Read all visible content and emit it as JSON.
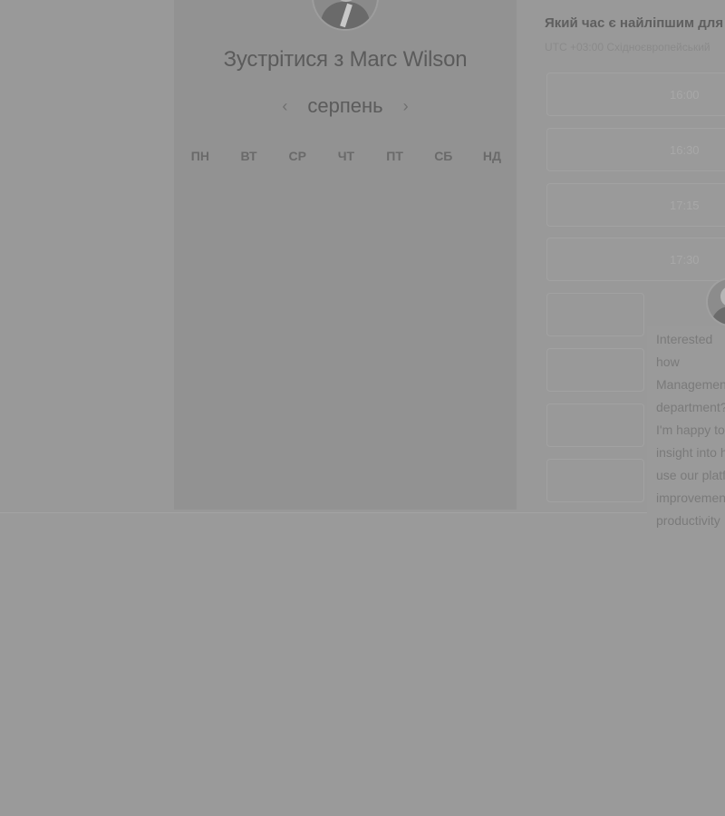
{
  "meeting": {
    "title": "Зустрітися з Marc Wilson",
    "month": "серпень",
    "prev_icon": "‹",
    "next_icon": "›",
    "weekdays": [
      "ПН",
      "ВТ",
      "СР",
      "ЧТ",
      "ПТ",
      "СБ",
      "НД"
    ]
  },
  "times": {
    "question": "Який час є найліпшим для",
    "timezone": "UTC +03:00 Східноєвропейський",
    "slots": [
      "16:00",
      "16:30",
      "17:15",
      "17:30"
    ]
  },
  "chat": {
    "paragraph1": "Interested how Management department?",
    "paragraph2": "I'm happy to insight into ho use our platfo improvement productivity"
  },
  "colors": {
    "overlay": "#9a9a9a",
    "card": "#929292",
    "text_dark": "#5b5b5b"
  }
}
